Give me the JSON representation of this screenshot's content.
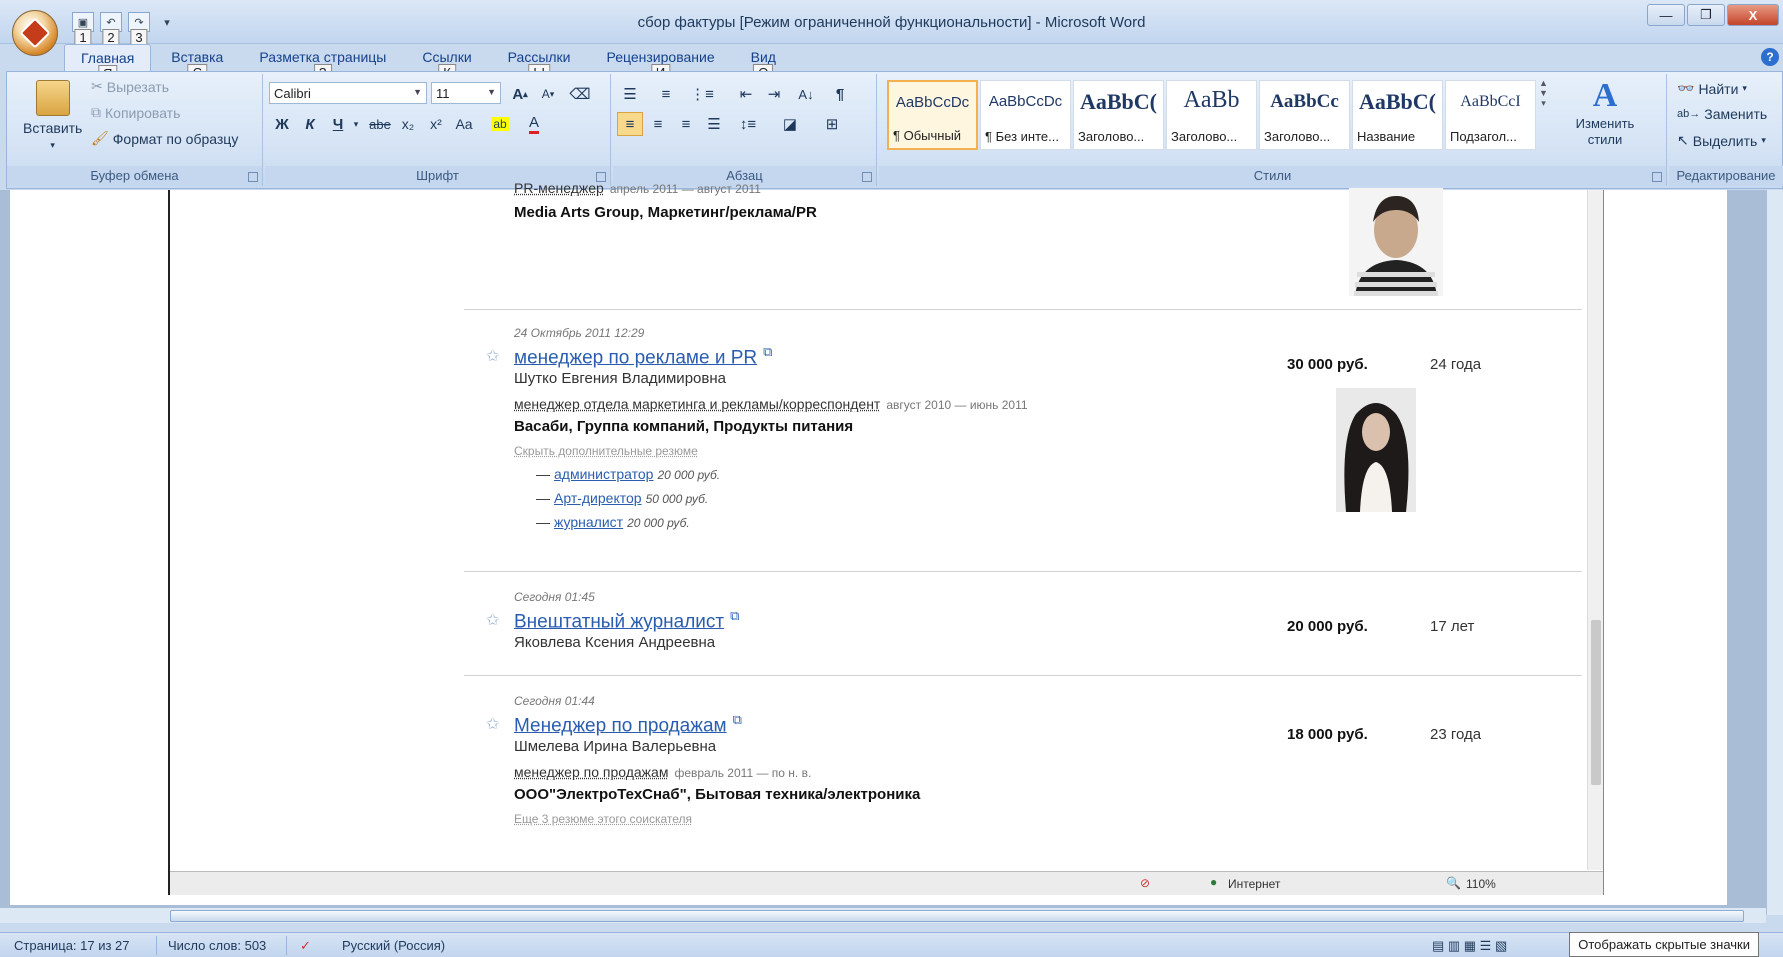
{
  "window": {
    "title": "сбор фактуры [Режим ограниченной функциональности] - Microsoft Word",
    "minimize": "—",
    "restore": "❐",
    "close": "X"
  },
  "qat_keytips": [
    "1",
    "2",
    "3"
  ],
  "tabs": [
    {
      "label": "Главная",
      "keytip": "Я",
      "active": true
    },
    {
      "label": "Вставка",
      "keytip": "С"
    },
    {
      "label": "Разметка страницы",
      "keytip": "З"
    },
    {
      "label": "Ссылки",
      "keytip": "К"
    },
    {
      "label": "Рассылки",
      "keytip": "Ы"
    },
    {
      "label": "Рецензирование",
      "keytip": "И"
    },
    {
      "label": "Вид",
      "keytip": "О"
    }
  ],
  "ribbon": {
    "clipboard": {
      "label": "Буфер обмена",
      "paste": "Вставить",
      "cut": "Вырезать",
      "copy": "Копировать",
      "format_painter": "Формат по образцу"
    },
    "font": {
      "label": "Шрифт",
      "font_name": "Calibri",
      "font_size": "11",
      "bold": "Ж",
      "italic": "К",
      "underline": "Ч",
      "strike": "abe",
      "subscript": "x₂",
      "superscript": "x²",
      "change_case": "Aa",
      "grow": "A",
      "shrink": "A"
    },
    "paragraph": {
      "label": "Абзац"
    },
    "styles": {
      "label": "Стили",
      "items": [
        {
          "sample": "AaBbCcDc",
          "name": "¶ Обычный",
          "active": true
        },
        {
          "sample": "AaBbCcDc",
          "name": "¶ Без инте..."
        },
        {
          "sample": "AaBbC(",
          "name": "Заголово..."
        },
        {
          "sample": "AaBb",
          "name": "Заголово..."
        },
        {
          "sample": "AaBbCc",
          "name": "Заголово..."
        },
        {
          "sample": "AaBbC(",
          "name": "Название"
        },
        {
          "sample": "AaBbCcI",
          "name": "Подзагол..."
        }
      ],
      "change_styles": "Изменить стили"
    },
    "editing": {
      "label": "Редактирование",
      "find": "Найти",
      "replace": "Заменить",
      "select": "Выделить"
    }
  },
  "document": {
    "entries": [
      {
        "prev_job": "PR-менеджер",
        "prev_period": "апрель 2011 — август 2011",
        "company": "Media Arts Group, Маркетинг/реклама/PR"
      },
      {
        "date": "24 Октябрь 2011 12:29",
        "title": "менеджер по рекламе и PR",
        "person": "Шутко Евгения Владимировна",
        "prev_job": "менеджер отдела маркетинга и рекламы/корреспондент",
        "prev_period": "август 2010 — июнь 2011",
        "company": "Васаби, Группа компаний, Продукты питания",
        "hide_link": "Скрыть дополнительные резюме",
        "sub_resumes": [
          {
            "title": "администратор",
            "salary": "20 000 руб."
          },
          {
            "title": "Арт-директор",
            "salary": "50 000 руб."
          },
          {
            "title": "журналист",
            "salary": "20 000 руб."
          }
        ],
        "salary": "30 000 руб.",
        "age": "24 года"
      },
      {
        "date": "Сегодня 01:45",
        "title": "Внештатный журналист",
        "person": "Яковлева Ксения Андреевна",
        "salary": "20 000 руб.",
        "age": "17 лет"
      },
      {
        "date": "Сегодня 01:44",
        "title": "Менеджер по продажам",
        "person": "Шмелева Ирина Валерьевна",
        "prev_job": "менеджер по продажам",
        "prev_period": "февраль 2011 — по н. в.",
        "company": "ООО\"ЭлектроТехСнаб\", Бытовая техника/электроника",
        "more_link": "Еще 3 резюме этого соискателя",
        "salary": "18 000 руб.",
        "age": "23 года"
      }
    ],
    "browser_status": {
      "zone": "Интернет",
      "zoom": "110%"
    }
  },
  "statusbar": {
    "page": "Страница: 17 из 27",
    "words": "Число слов: 503",
    "language": "Русский (Россия)",
    "tooltip": "Отображать скрытые значки"
  },
  "colors": {
    "accent": "#15428b",
    "link": "#2a5db0",
    "ribbon_bg": "#dbe7f6"
  }
}
